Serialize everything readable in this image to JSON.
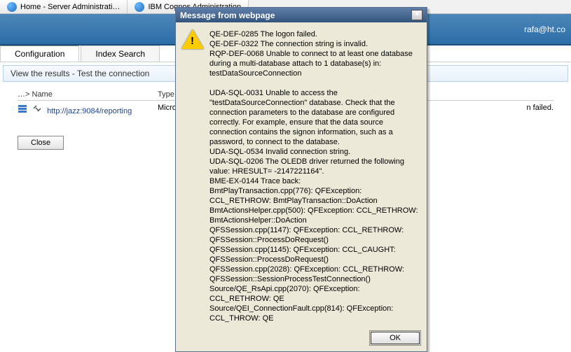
{
  "browserTabs": {
    "tab1": "Home - Server Administrati…",
    "tab2": "IBM Cognos Administration"
  },
  "header": {
    "user": "rafa@ht.co"
  },
  "mainTabs": {
    "config": "Configuration",
    "index": "Index Search"
  },
  "subHeader": "View the results - Test the connection",
  "table": {
    "breadcrumb": "…>",
    "colName": "Name",
    "colType": "Type",
    "rowUrl": "http://jazz:9084/reporting",
    "rowType": "Micro",
    "rowMsgTail": "n failed."
  },
  "closeLabel": "Close",
  "dialog": {
    "title": "Message from webpage",
    "closeX": "×",
    "ok": "OK",
    "messageLines": [
      "QE-DEF-0285 The logon failed.",
      "QE-DEF-0322 The connection string is invalid.",
      "RQP-DEF-0068 Unable to connect to at least one database during a multi-database attach to 1 database(s) in:",
      "    testDataSourceConnection",
      "",
      "UDA-SQL-0031 Unable to access the \"testDataSourceConnection\" database. Check that the connection parameters to the database are configured correctly. For example, ensure that the data source connection contains the signon information, such as a password, to connect to the database.",
      "UDA-SQL-0534 Invalid connection string.",
      "UDA-SQL-0206 The OLEDB driver returned the following value: HRESULT= -2147221164\".",
      "BME-EX-0144 Trace back:",
      "BmtPlayTransaction.cpp(776): QFException: CCL_RETHROW: BmtPlayTransaction::DoAction",
      "BmtActionsHelper.cpp(500): QFException: CCL_RETHROW: BmtActionsHelper::DoAction",
      "QFSSession.cpp(1147): QFException: CCL_RETHROW: QFSSession::ProcessDoRequest()",
      "QFSSession.cpp(1145): QFException: CCL_CAUGHT: QFSSession::ProcessDoRequest()",
      "QFSSession.cpp(2028): QFException: CCL_RETHROW: QFSSession::SessionProcessTestConnection()",
      "Source/QE_RsApi.cpp(2070): QFException: CCL_RETHROW: QE",
      "Source/QEI_ConnectionFault.cpp(814): QFException: CCL_THROW: QE"
    ]
  }
}
